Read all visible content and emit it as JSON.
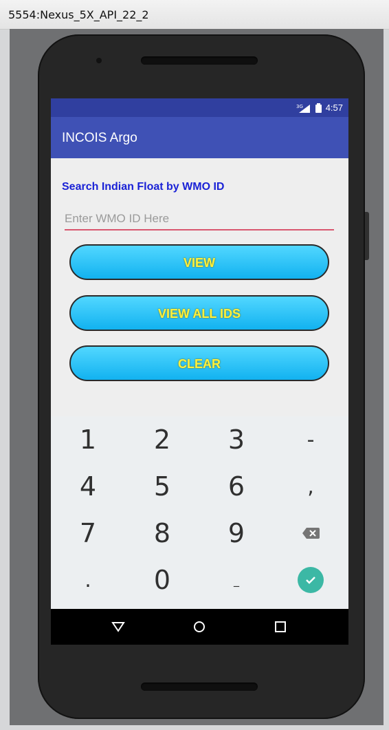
{
  "window": {
    "title": "5554:Nexus_5X_API_22_2"
  },
  "status_bar": {
    "network_label": "3G",
    "time": "4:57"
  },
  "app_bar": {
    "title": "INCOIS Argo"
  },
  "form": {
    "label": "Search Indian Float by WMO ID",
    "input_placeholder": "Enter WMO ID Here",
    "input_value": ""
  },
  "buttons": {
    "view": "VIEW",
    "view_all": "VIEW ALL IDS",
    "clear": "CLEAR"
  },
  "keypad": {
    "rows": [
      [
        "1",
        "2",
        "3",
        "-"
      ],
      [
        "4",
        "5",
        "6",
        ","
      ],
      [
        "7",
        "8",
        "9",
        "backspace-icon"
      ],
      [
        ".",
        "0",
        "_",
        "done-icon"
      ]
    ]
  },
  "nav": {
    "back_icon": "back-triangle-icon",
    "home_icon": "home-circle-icon",
    "recents_icon": "recents-square-icon"
  },
  "colors": {
    "status_bar": "#303f9f",
    "toolbar": "#3f51b5",
    "label": "#1a22d6",
    "input_underline": "#d8566f",
    "button_bg": "#12b2f0",
    "button_text": "#fff13d",
    "keypad_bg": "#eceff1",
    "done_key": "#3cb8a5"
  }
}
